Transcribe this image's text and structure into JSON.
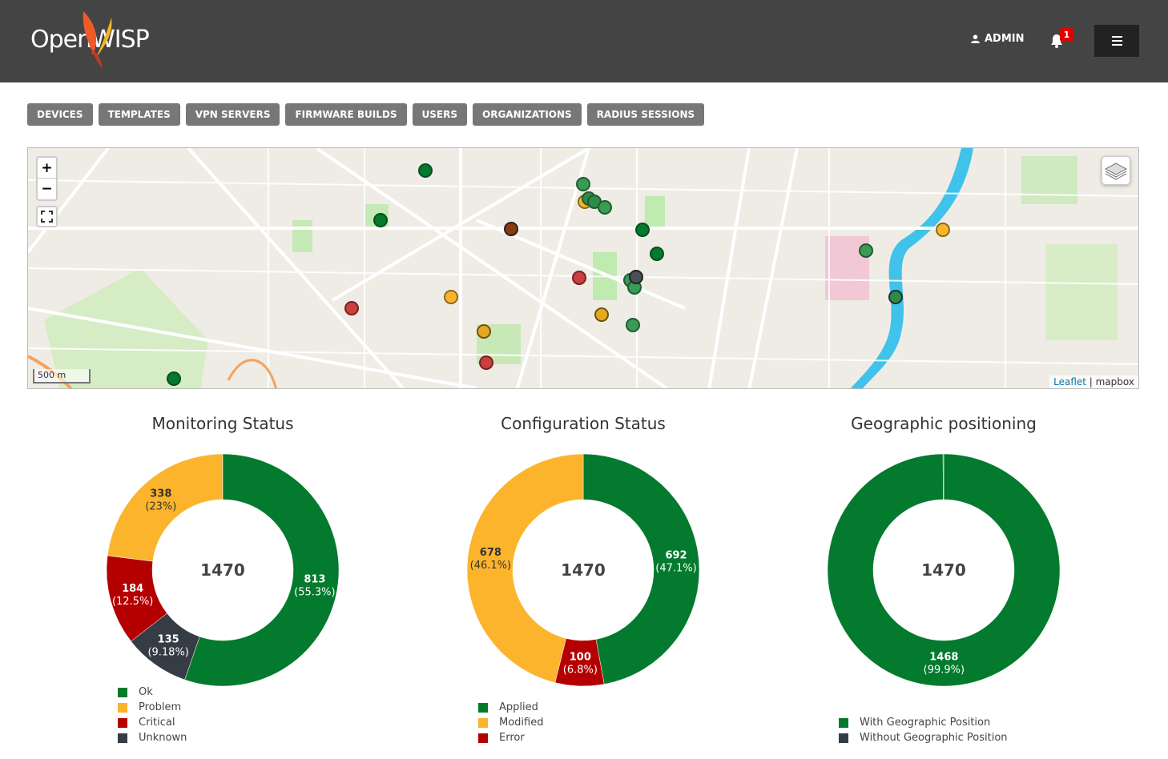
{
  "header": {
    "logo_text": "OpenWISP",
    "admin_label": "ADMIN",
    "notification_count": "1"
  },
  "nav": {
    "items": [
      "DEVICES",
      "TEMPLATES",
      "VPN SERVERS",
      "FIRMWARE BUILDS",
      "USERS",
      "ORGANIZATIONS",
      "RADIUS SESSIONS"
    ]
  },
  "map": {
    "zoom_in": "+",
    "zoom_out": "−",
    "scale_label": "500 m",
    "attribution_link": "Leaflet",
    "attribution_sep": " | ",
    "attribution_text": "mapbox",
    "markers": [
      {
        "status": "ok"
      },
      {
        "status": "ok"
      },
      {
        "status": "ok"
      },
      {
        "status": "ok"
      },
      {
        "status": "problem"
      },
      {
        "status": "ok"
      },
      {
        "status": "ok"
      },
      {
        "status": "ok"
      },
      {
        "status": "unknown"
      },
      {
        "status": "ok"
      },
      {
        "status": "ok"
      },
      {
        "status": "critical"
      },
      {
        "status": "problem"
      },
      {
        "status": "critical"
      },
      {
        "status": "problem"
      },
      {
        "status": "problem"
      },
      {
        "status": "ok"
      },
      {
        "status": "critical"
      },
      {
        "status": "ok"
      },
      {
        "status": "ok"
      },
      {
        "status": "problem"
      },
      {
        "status": "ok"
      },
      {
        "status": "unknown"
      },
      {
        "status": "ok"
      }
    ]
  },
  "colors": {
    "ok": "#037a2d",
    "problem": "#fcb42d",
    "critical": "#b40000",
    "unknown": "#353c44"
  },
  "charts": [
    {
      "title": "Monitoring Status",
      "total": "1470",
      "slices": [
        {
          "label": "Ok",
          "value": "813",
          "pct": "(55.3%)",
          "color": "#037a2d",
          "fraction": 0.553
        },
        {
          "label": "Unknown",
          "value": "135",
          "pct": "(9.18%)",
          "color": "#353c44",
          "fraction": 0.0918
        },
        {
          "label": "Critical",
          "value": "184",
          "pct": "(12.5%)",
          "color": "#b40000",
          "fraction": 0.125
        },
        {
          "label": "Problem",
          "value": "338",
          "pct": "(23%)",
          "color": "#fcb42d",
          "fraction": 0.23
        }
      ],
      "legend": [
        {
          "label": "Ok",
          "color": "#037a2d"
        },
        {
          "label": "Problem",
          "color": "#fcb42d"
        },
        {
          "label": "Critical",
          "color": "#b40000"
        },
        {
          "label": "Unknown",
          "color": "#353c44"
        }
      ]
    },
    {
      "title": "Configuration Status",
      "total": "1470",
      "slices": [
        {
          "label": "Applied",
          "value": "692",
          "pct": "(47.1%)",
          "color": "#037a2d",
          "fraction": 0.471
        },
        {
          "label": "Error",
          "value": "100",
          "pct": "(6.8%)",
          "color": "#b40000",
          "fraction": 0.068
        },
        {
          "label": "Modified",
          "value": "678",
          "pct": "(46.1%)",
          "color": "#fcb42d",
          "fraction": 0.461
        }
      ],
      "legend": [
        {
          "label": "Applied",
          "color": "#037a2d"
        },
        {
          "label": "Modified",
          "color": "#fcb42d"
        },
        {
          "label": "Error",
          "color": "#b40000"
        }
      ]
    },
    {
      "title": "Geographic positioning",
      "total": "1470",
      "slices": [
        {
          "label": "With Geographic Position",
          "value": "1468",
          "pct": "(99.9%)",
          "color": "#037a2d",
          "fraction": 0.999
        },
        {
          "label": "Without Geographic Position",
          "value": "",
          "pct": "",
          "color": "#353c44",
          "fraction": 0.001
        }
      ],
      "legend": [
        {
          "label": "With Geographic Position",
          "color": "#037a2d"
        },
        {
          "label": "Without Geographic Position",
          "color": "#353c44"
        }
      ]
    }
  ]
}
